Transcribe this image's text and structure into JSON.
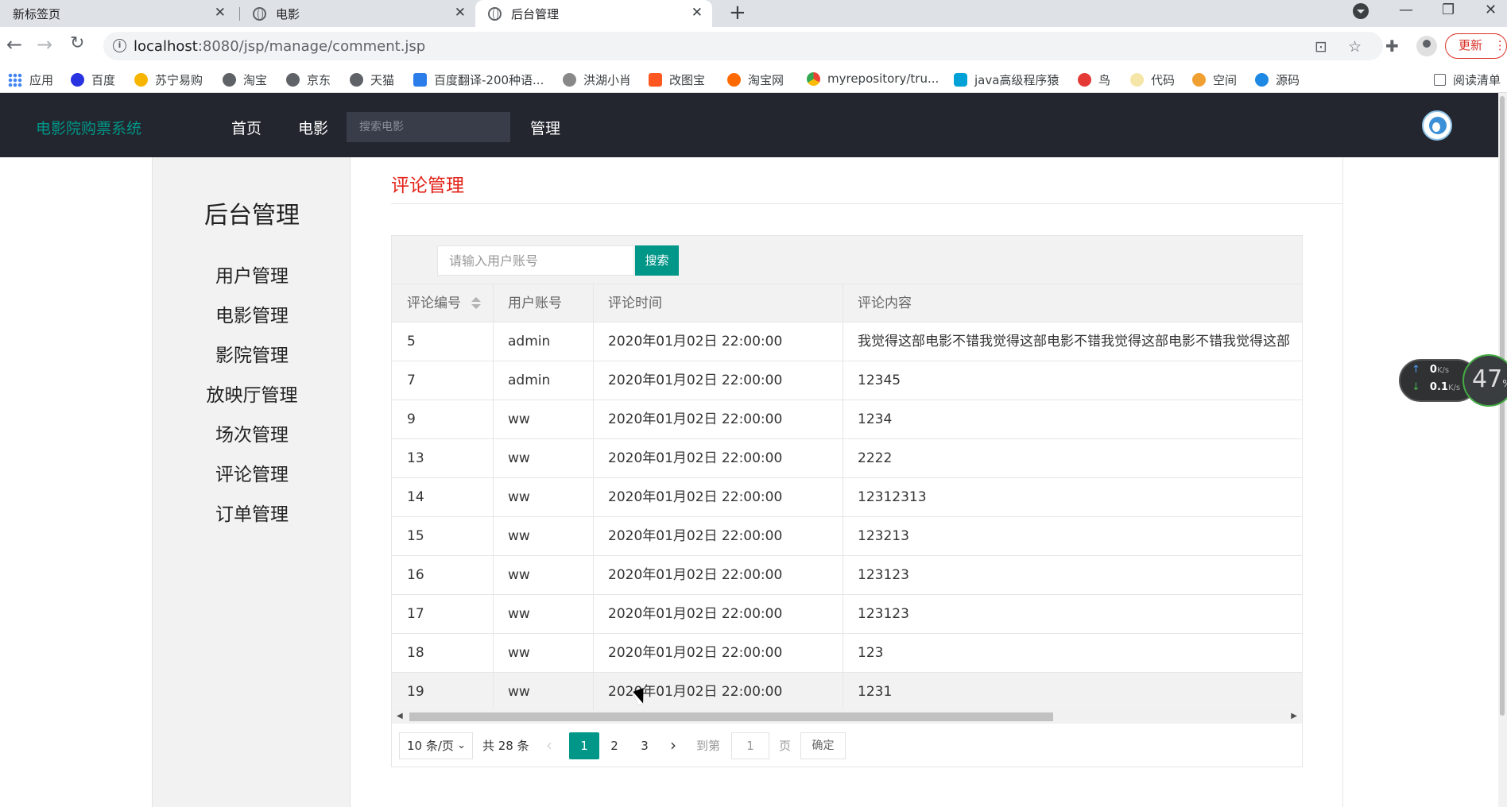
{
  "browser": {
    "tabs": [
      {
        "title": "新标签页",
        "active": false
      },
      {
        "title": "电影",
        "active": false
      },
      {
        "title": "后台管理",
        "active": true
      }
    ],
    "url_host": "localhost",
    "url_rest": ":8080/jsp/manage/comment.jsp",
    "update_label": "更新",
    "bookmarks": [
      "应用",
      "百度",
      "苏宁易购",
      "淘宝",
      "京东",
      "天猫",
      "百度翻译-200种语...",
      "洪湖小肖",
      "改图宝",
      "淘宝网",
      "myrepository/tru...",
      "java高级程序猿",
      "鸟",
      "代码",
      "空间",
      "源码",
      "阅读清单"
    ]
  },
  "site": {
    "brand": "电影院购票系统",
    "nav": [
      "首页",
      "电影",
      "管理"
    ],
    "search_placeholder": "搜索电影"
  },
  "sidebar": {
    "title": "后台管理",
    "items": [
      "用户管理",
      "电影管理",
      "影院管理",
      "放映厅管理",
      "场次管理",
      "评论管理",
      "订单管理"
    ]
  },
  "content": {
    "title": "评论管理",
    "search_placeholder": "请输入用户账号",
    "search_button": "搜索",
    "columns": [
      "评论编号",
      "用户账号",
      "评论时间",
      "评论内容"
    ],
    "rows": [
      {
        "id": "5",
        "user": "admin",
        "time": "2020年01月02日 22:00:00",
        "content": "我觉得这部电影不错我觉得这部电影不错我觉得这部电影不错我觉得这部"
      },
      {
        "id": "7",
        "user": "admin",
        "time": "2020年01月02日 22:00:00",
        "content": "12345"
      },
      {
        "id": "9",
        "user": "ww",
        "time": "2020年01月02日 22:00:00",
        "content": "1234"
      },
      {
        "id": "13",
        "user": "ww",
        "time": "2020年01月02日 22:00:00",
        "content": "2222"
      },
      {
        "id": "14",
        "user": "ww",
        "time": "2020年01月02日 22:00:00",
        "content": "12312313"
      },
      {
        "id": "15",
        "user": "ww",
        "time": "2020年01月02日 22:00:00",
        "content": "123213"
      },
      {
        "id": "16",
        "user": "ww",
        "time": "2020年01月02日 22:00:00",
        "content": "123123"
      },
      {
        "id": "17",
        "user": "ww",
        "time": "2020年01月02日 22:00:00",
        "content": "123123"
      },
      {
        "id": "18",
        "user": "ww",
        "time": "2020年01月02日 22:00:00",
        "content": "123"
      },
      {
        "id": "19",
        "user": "ww",
        "time": "2020年01月02日 22:00:00",
        "content": "1231"
      }
    ]
  },
  "pager": {
    "page_size": "10 条/页",
    "total": "共 28 条",
    "pages": [
      "1",
      "2",
      "3"
    ],
    "current": "1",
    "goto_label": "到第",
    "goto_value": "1",
    "page_unit": "页",
    "confirm": "确定"
  },
  "speed_widget": {
    "up_value": "0",
    "up_unit": "K/s",
    "down_value": "0.1",
    "down_unit": "K/s",
    "percent": "47",
    "percent_unit": "%"
  },
  "colors": {
    "accent": "#009688",
    "title_red": "#e2231a",
    "navbar": "#23262e"
  }
}
